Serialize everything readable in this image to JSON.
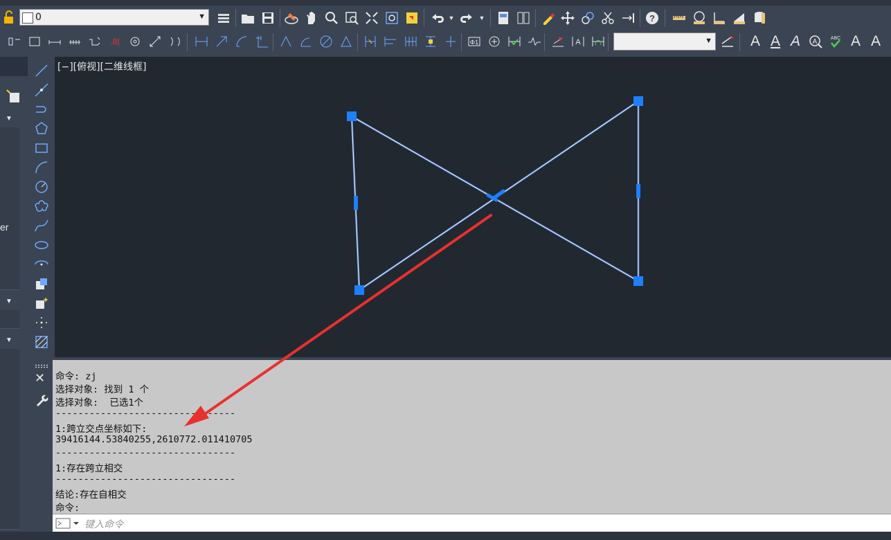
{
  "toolbar": {
    "layer_value": "0",
    "icons_row1": [
      "layer-tools-icon",
      "open-icon",
      "save-icon",
      "eraser-icon",
      "pan-icon",
      "zoom-realtime-icon",
      "zoom-window-icon",
      "zoom-extents-icon",
      "zoom-previous-icon",
      "3d-view-icon",
      "undo-icon",
      "undo-dropdown-icon",
      "redo-icon",
      "redo-dropdown-icon",
      "properties-icon",
      "design-center-icon",
      "match-properties-icon",
      "move-icon",
      "copy-icon",
      "trim-icon",
      "extend-icon",
      "help-icon",
      "measure-distance-icon",
      "measure-radius-icon",
      "measure-angle-icon",
      "measure-area-icon",
      "measure-volume-icon"
    ],
    "icons_row2": [
      "dim-linear-icon",
      "dim-aligned-icon",
      "dim-arc-icon",
      "dim-ordinate-icon",
      "dim-radius-icon",
      "dim-jogged-icon",
      "dim-diameter-icon",
      "dim-angular-icon",
      "quick-dim-icon",
      "baseline-icon",
      "continue-icon",
      "dim-space-icon",
      "dim-break-icon",
      "tolerance-icon",
      "center-mark-icon",
      "inspect-icon",
      "jogged-linear-icon",
      "dim-edit-icon",
      "dim-text-edit-icon",
      "dim-update-icon",
      "text-style-icon",
      "text-icon",
      "text-annotative-icon",
      "edit-text-icon",
      "find-text-icon",
      "spell-check-icon",
      "text-scale-icon",
      "text-justify-icon"
    ]
  },
  "canvas": {
    "view_label": "[−][俯视][二维线框]",
    "bg_color": "#212830",
    "line_color": "#bfd4ff",
    "grip_color": "#1e7fff"
  },
  "left_panel": {
    "partial_text": "er"
  },
  "command": {
    "lines": [
      "命令: zj",
      "选择对象: 找到 1 个",
      "选择对象:  已选1个",
      "--------------------------------",
      "1:跨立交点坐标如下:",
      "39416144.53840255,2610772.011410705",
      "--------------------------------",
      "1:存在跨立相交",
      "--------------------------------",
      "结论:存在自相交",
      "命令:"
    ],
    "input_placeholder": "键入命令"
  },
  "annotation_arrow_color": "#e8312f"
}
